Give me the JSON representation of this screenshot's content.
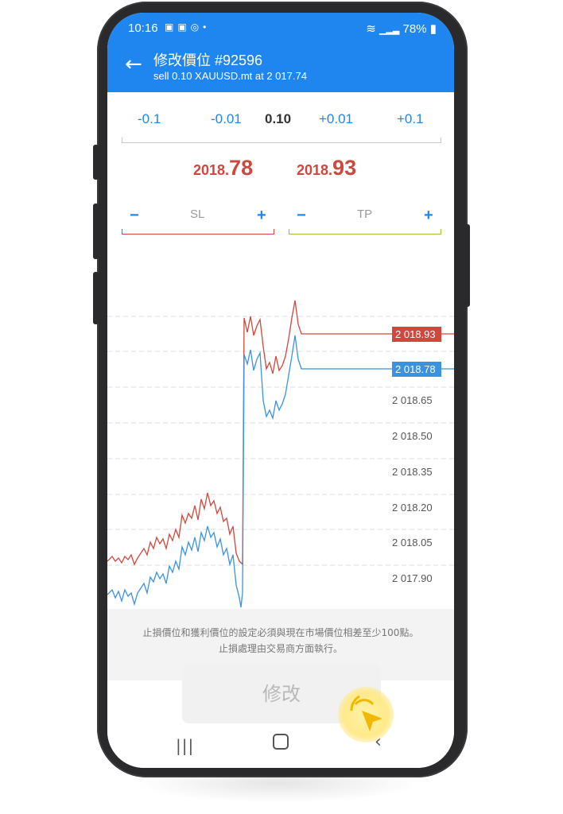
{
  "status": {
    "time": "10:16",
    "battery": "78%"
  },
  "header": {
    "title": "修改價位 #92596",
    "subtitle": "sell 0.10 XAUUSD.mt at 2 017.74"
  },
  "volume": {
    "minus_big": "-0.1",
    "minus_small": "-0.01",
    "current": "0.10",
    "plus_small": "+0.01",
    "plus_big": "+0.1"
  },
  "prices": {
    "sl_small": "2018.",
    "sl_big": "78",
    "tp_small": "2018.",
    "tp_big": "93"
  },
  "sltp": {
    "sl_label": "SL",
    "tp_label": "TP",
    "minus": "−",
    "plus": "+"
  },
  "chart": {
    "labels": [
      "2 018.65",
      "2 018.50",
      "2 018.35",
      "2 018.20",
      "2 018.05",
      "2 017.90"
    ],
    "ask_tag": "2 018.93",
    "bid_tag": "2 018.78",
    "ask_color": "#d0473d",
    "bid_color": "#3a93e0"
  },
  "note": {
    "line1": "止損價位和獲利價位的設定必須與現在市場價位相差至少100點。",
    "line2": "止損處理由交易商方面執行。"
  },
  "modify_button": "修改"
}
